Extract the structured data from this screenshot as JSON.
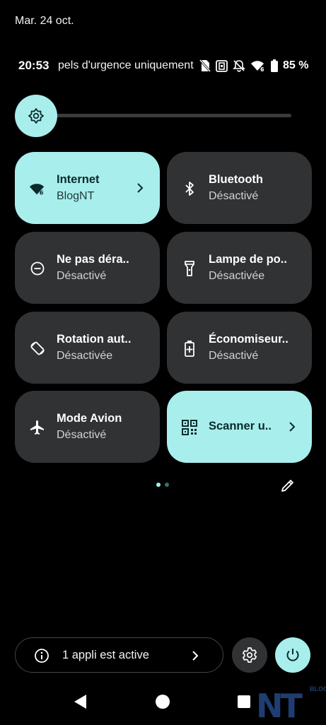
{
  "header": {
    "date": "Mar. 24 oct.",
    "time": "20:53",
    "carrier_text": "pels d'urgence uniquement",
    "battery": "85 %",
    "icons": [
      "no-sim-icon",
      "nfc-icon",
      "silent-icon",
      "wifi-6-icon",
      "battery-icon"
    ]
  },
  "brightness": {
    "icon": "brightness-icon",
    "level": 0.0
  },
  "tiles": [
    {
      "title": "Internet",
      "subtitle": "BlogNT",
      "icon": "wifi-6-icon",
      "active": true,
      "chevron": true
    },
    {
      "title": "Bluetooth",
      "subtitle": "Désactivé",
      "icon": "bluetooth-icon",
      "active": false
    },
    {
      "title": "Ne pas déra..",
      "subtitle": "Désactivé",
      "icon": "do-not-disturb-icon",
      "active": false
    },
    {
      "title": "Lampe de po..",
      "subtitle": "Désactivée",
      "icon": "flashlight-icon",
      "active": false
    },
    {
      "title": "Rotation aut..",
      "subtitle": "Désactivée",
      "icon": "auto-rotate-icon",
      "active": false
    },
    {
      "title": "Économiseur..",
      "subtitle": "Désactivé",
      "icon": "battery-saver-icon",
      "active": false
    },
    {
      "title": "Mode Avion",
      "subtitle": "Désactivé",
      "icon": "airplane-icon",
      "active": false
    },
    {
      "title": "Scanner u..",
      "icon": "qr-code-icon",
      "active": true,
      "chevron": true
    }
  ],
  "pager": {
    "pages": 2,
    "current": 1
  },
  "footer": {
    "apps_active_label": "1 appli est active",
    "settings_icon": "gear-icon",
    "power_icon": "power-icon"
  },
  "watermark": {
    "logo": "NT",
    "tag": "BLOG"
  },
  "colors": {
    "accent": "#a8eeec",
    "tile": "#303233",
    "background": "#000000"
  }
}
